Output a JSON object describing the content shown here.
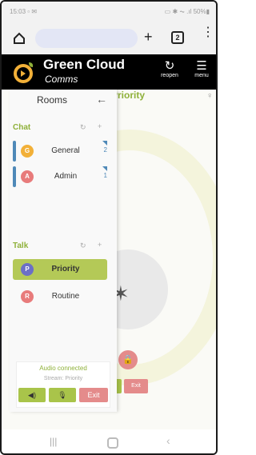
{
  "statusbar": {
    "time": "15:03",
    "left_icons": "▫ ✉",
    "right_text": "▭ ✱ ⏦ .ıl 50%▮"
  },
  "browser": {
    "tabs_count": "2",
    "kebab": "⋮"
  },
  "app": {
    "brand_title": "Green Cloud",
    "brand_subtitle": "Comms",
    "reopen_label": "reopen",
    "menu_label": "menu"
  },
  "main": {
    "title": "Priority",
    "lock_glyph": "🔒",
    "exit_label": "Exit"
  },
  "sidebar": {
    "title": "Rooms",
    "chat_label": "Chat",
    "talk_label": "Talk",
    "chat_rooms": [
      {
        "initial": "G",
        "name": "General",
        "count": "2",
        "color": "#f2b038"
      },
      {
        "initial": "A",
        "name": "Admin",
        "count": "1",
        "color": "#e87b7b"
      }
    ],
    "talk_rooms": [
      {
        "initial": "P",
        "name": "Priority",
        "color": "#6b6fc6"
      },
      {
        "initial": "R",
        "name": "Routine",
        "color": "#e87b7b"
      }
    ],
    "audio_status": "Audio connected",
    "stream_label": "Stream: Priority",
    "exit_label": "Exit"
  },
  "colors": {
    "accent": "#8fb13a",
    "active_room": "#b4c957",
    "danger": "#e48b8b",
    "header": "#000000"
  }
}
